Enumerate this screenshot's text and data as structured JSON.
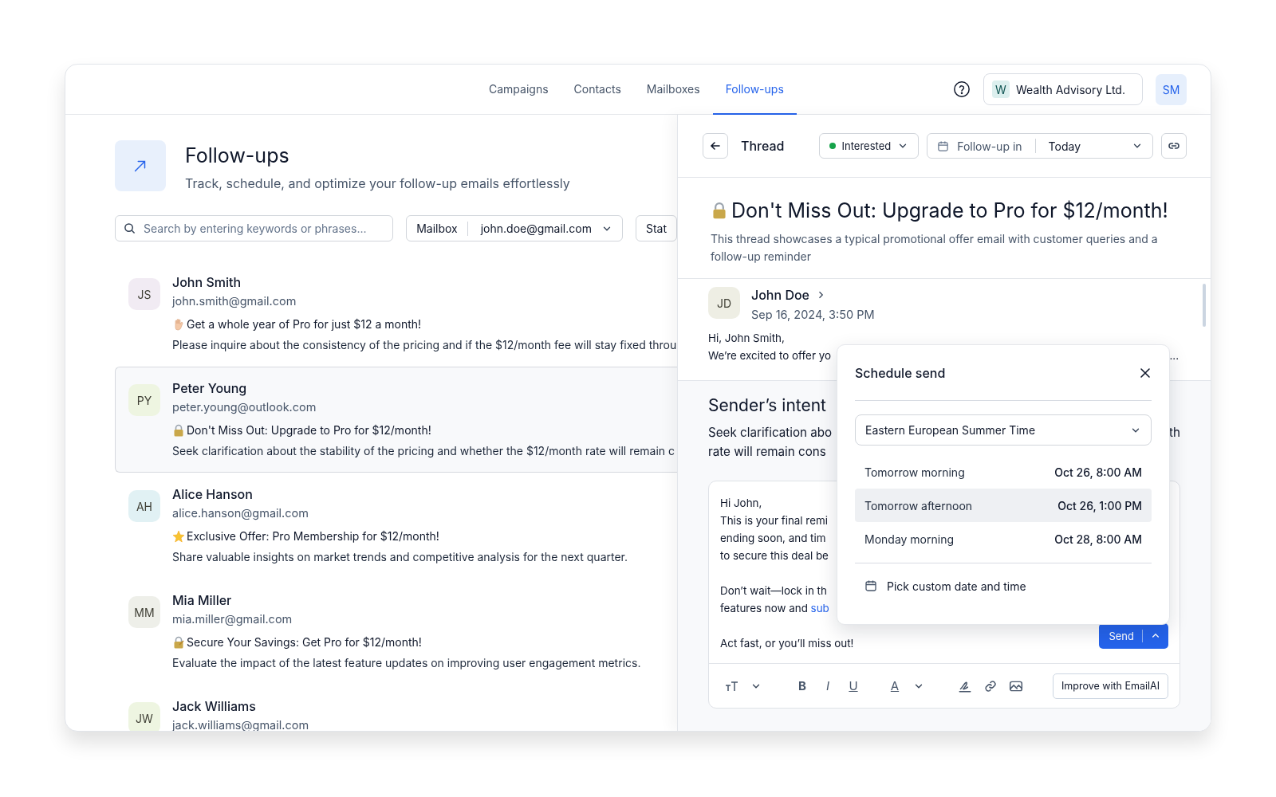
{
  "nav": {
    "tabs": [
      {
        "label": "Campaigns",
        "selected": false
      },
      {
        "label": "Contacts",
        "selected": false
      },
      {
        "label": "Mailboxes",
        "selected": false
      },
      {
        "label": "Follow-ups",
        "selected": true
      }
    ],
    "org": {
      "initial": "W",
      "name": "Wealth Advisory Ltd."
    },
    "user": {
      "initials": "SM"
    }
  },
  "page": {
    "title": "Follow-ups",
    "subtitle": "Track, schedule, and optimize your follow-up emails effortlessly",
    "search": {
      "placeholder": "Search by entering keywords or phrases..."
    },
    "filters": [
      {
        "label": "Mailbox",
        "value": "john.doe@gmail.com"
      },
      {
        "label": "Stat"
      }
    ]
  },
  "contacts": [
    {
      "initials": "JS",
      "color": "#f1ebf3",
      "name": "John Smith",
      "email": "john.smith@gmail.com",
      "kind": "hand",
      "subject": "Get a whole year of Pro for just $12 a month!",
      "preview": "Please inquire about the consistency of the pricing and if the $12/month fee will stay fixed throu",
      "selected": false
    },
    {
      "initials": "PY",
      "color": "#eef5e1",
      "name": "Peter Young",
      "email": "peter.young@outlook.com",
      "kind": "lock",
      "subject": "Don't Miss Out: Upgrade to Pro for $12/month!",
      "preview": "Seek clarification about the stability of the pricing and whether the $12/month rate will remain c",
      "selected": true
    },
    {
      "initials": "AH",
      "color": "#e1f1f4",
      "name": "Alice Hanson",
      "email": "alice.hanson@gmail.com",
      "kind": "star",
      "subject": "Exclusive Offer: Pro Membership for $12/month!",
      "preview": "Share valuable insights on market trends and competitive analysis for the next quarter.",
      "selected": false
    },
    {
      "initials": "MM",
      "color": "#eeefe9",
      "name": "Mia Miller",
      "email": "mia.miller@gmail.com",
      "kind": "lock-key",
      "subject": "Secure Your Savings: Get Pro for $12/month!",
      "preview": "Evaluate the impact of the latest feature updates on improving user engagement metrics.",
      "selected": false
    },
    {
      "initials": "JW",
      "color": "#eef5e1",
      "name": "Jack Williams",
      "email": "jack.williams@gmail.com",
      "selected": false
    }
  ],
  "thread": {
    "header": {
      "title": "Thread",
      "status": {
        "label": "Interested",
        "color": "#16a34a"
      },
      "followup": {
        "label": "Follow-up in",
        "value": "Today"
      }
    },
    "kind": "lock",
    "title": "Don't Miss Out: Upgrade to Pro for $12/month!",
    "description": "This thread showcases a typical promotional offer email with customer queries and a follow-up reminder",
    "message": {
      "initials": "JD",
      "color": "#eeeee4",
      "sender": "John Doe",
      "date": "Sep 16, 2024, 3:50 PM",
      "lines": [
        "Hi, John Smith,",
        "We’re excited to offer yo"
      ],
      "ellipsis": "..."
    },
    "intent": {
      "title": "Sender’s intent",
      "line_1_start": "Seek clarification abo",
      "line_1_end": "th",
      "line_2": "rate will remain cons"
    },
    "reply": {
      "paragraphs": [
        [
          {
            "text": "Hi John,"
          },
          {
            "text": "This is your final remi"
          },
          {
            "text": "ending soon, and tim"
          },
          {
            "text": "to secure this deal be"
          }
        ],
        [
          {
            "text": "Don’t wait—lock in th"
          },
          {
            "text": "features now and ",
            "link": "sub"
          }
        ],
        [
          {
            "text": "Act fast, or you’ll miss out!"
          }
        ]
      ],
      "send": "Send",
      "toolbar": [
        "B",
        "I",
        "U",
        "A"
      ],
      "improve": "Improve with EmailAI"
    }
  },
  "schedule": {
    "title": "Schedule send",
    "timezone": "Eastern European Summer Time",
    "options": [
      {
        "label": "Tomorrow morning",
        "time": "Oct 26, 8:00 AM",
        "selected": false
      },
      {
        "label": "Tomorrow afternoon",
        "time": "Oct 26, 1:00 PM",
        "selected": true
      },
      {
        "label": "Monday morning",
        "time": "Oct 28, 8:00 AM",
        "selected": false
      }
    ],
    "custom": "Pick custom date and time"
  }
}
